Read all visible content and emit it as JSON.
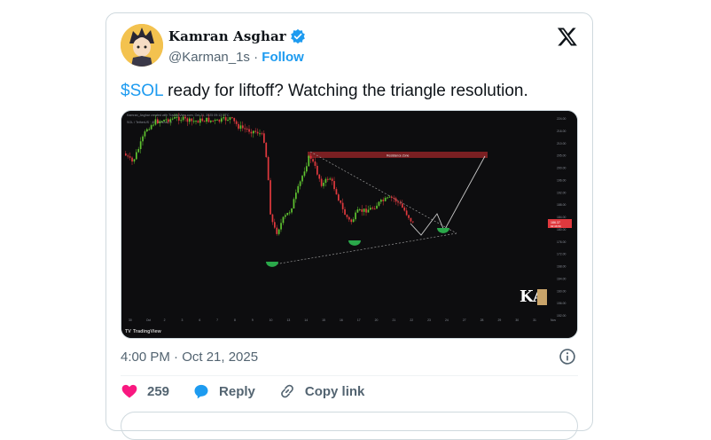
{
  "tweet": {
    "display_name": "Kamran Asghar",
    "handle": "@Karman_1s",
    "separator": "·",
    "follow_label": "Follow",
    "cashtag": "$SOL",
    "text_rest": " ready for liftoff? Watching the triangle resolution.",
    "timestamp": "4:00 PM · Oct 21, 2025"
  },
  "chart": {
    "header_text": "Kamran_Asghar created with TradingView.com, Oct 21, 2025 09:13 UTC",
    "symbol_text": "SOL / TetherUS · 4h · BINANCE",
    "resistance_label": "Resistance Zone",
    "price_badge": "186.37",
    "price_badge_sub": "02:46:59",
    "watermark": "TradingView",
    "y_ticks": [
      "224.00",
      "216.00",
      "210.00",
      "205.00",
      "200.00",
      "196.00",
      "192.00",
      "188.00",
      "184.00",
      "180.00",
      "176.00",
      "172.00",
      "168.00",
      "164.00",
      "160.00",
      "156.00",
      "152.00"
    ],
    "x_ticks": [
      "30",
      "Oct",
      "2",
      "3",
      "6",
      "7",
      "8",
      "9",
      "10",
      "13",
      "14",
      "15",
      "16",
      "17",
      "20",
      "21",
      "22",
      "23",
      "24",
      "27",
      "28",
      "29",
      "30",
      "31",
      "Nov"
    ]
  },
  "actions": {
    "like_count": "259",
    "reply_label": "Reply",
    "copy_link_label": "Copy link"
  },
  "colors": {
    "accent": "#1d9bf0",
    "like": "#f91880",
    "candle_up": "#5fc330",
    "candle_down": "#e0393e"
  }
}
